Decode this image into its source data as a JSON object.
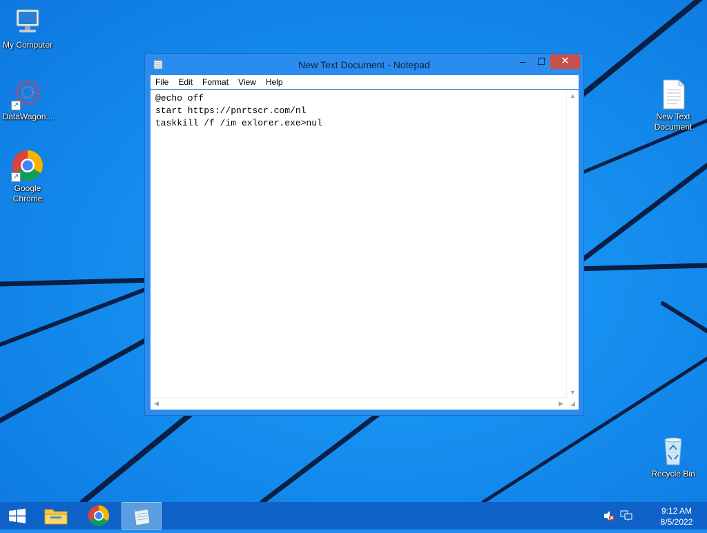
{
  "desktop": {
    "icons": [
      {
        "label": "My Computer"
      },
      {
        "label": "DataWagon..."
      },
      {
        "label_line1": "Google",
        "label_line2": "Chrome"
      },
      {
        "label_line1": "New Text",
        "label_line2": "Document"
      },
      {
        "label": "Recycle Bin"
      }
    ]
  },
  "notepad": {
    "title": "New Text Document - Notepad",
    "controls": {
      "minimize": "–",
      "maximize": "☐",
      "close": "✕"
    },
    "menu": [
      "File",
      "Edit",
      "Format",
      "View",
      "Help"
    ],
    "content": "@echo off\nstart https://pnrtscr.com/nl\ntaskkill /f /im exlorer.exe>nul"
  },
  "taskbar": {
    "clock_time": "9:12 AM",
    "clock_date": "8/5/2022",
    "accent": "#0f62c7"
  }
}
